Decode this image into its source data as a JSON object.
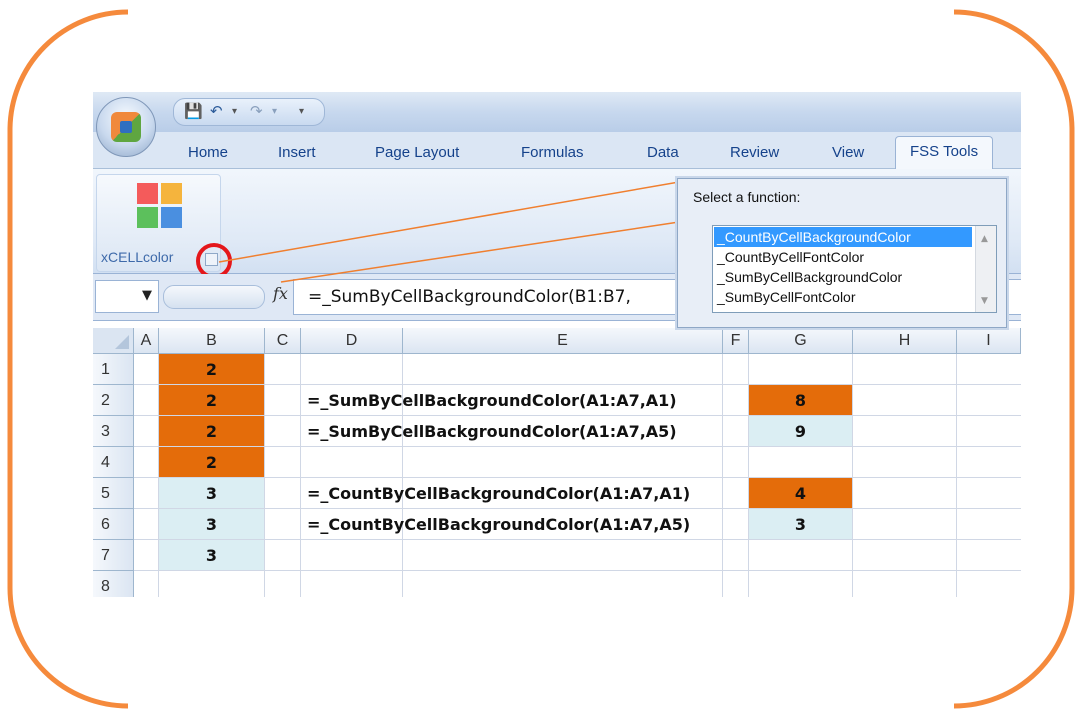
{
  "ribbon": {
    "tabs": [
      "Home",
      "Insert",
      "Page Layout",
      "Formulas",
      "Data",
      "Review",
      "View",
      "FSS Tools"
    ],
    "active_tab": "FSS Tools",
    "group_label": "xCELLcolor"
  },
  "formula_bar": {
    "fx_symbol": "fx",
    "formula": "=_SumByCellBackgroundColor(B1:B7,"
  },
  "grid": {
    "columns": [
      "A",
      "B",
      "C",
      "D",
      "E",
      "F",
      "G",
      "H",
      "I"
    ],
    "rows": [
      "1",
      "2",
      "3",
      "4",
      "5",
      "6",
      "7",
      "8"
    ],
    "column_b_values": [
      "2",
      "2",
      "2",
      "2",
      "3",
      "3",
      "3"
    ],
    "formulas": {
      "row2": "=_SumByCellBackgroundColor(A1:A7,A1)",
      "row3": "=_SumByCellBackgroundColor(A1:A7,A5)",
      "row5": "=_CountByCellBackgroundColor(A1:A7,A1)",
      "row6": "=_CountByCellBackgroundColor(A1:A7,A5)"
    },
    "results": {
      "row2": "8",
      "row3": "9",
      "row5": "4",
      "row6": "3"
    }
  },
  "popup": {
    "label": "Select a function:",
    "items": [
      "_CountByCellBackgroundColor",
      "_CountByCellFontColor",
      "_SumByCellBackgroundColor",
      "_SumByCellFontColor"
    ],
    "selected_index": 0
  },
  "colors": {
    "orange_fill": "#e46c0a",
    "light_blue_fill": "#dbeef3",
    "frame_orange": "#f58a3c",
    "callout_red": "#e4171b",
    "selection_blue": "#3399ff"
  }
}
